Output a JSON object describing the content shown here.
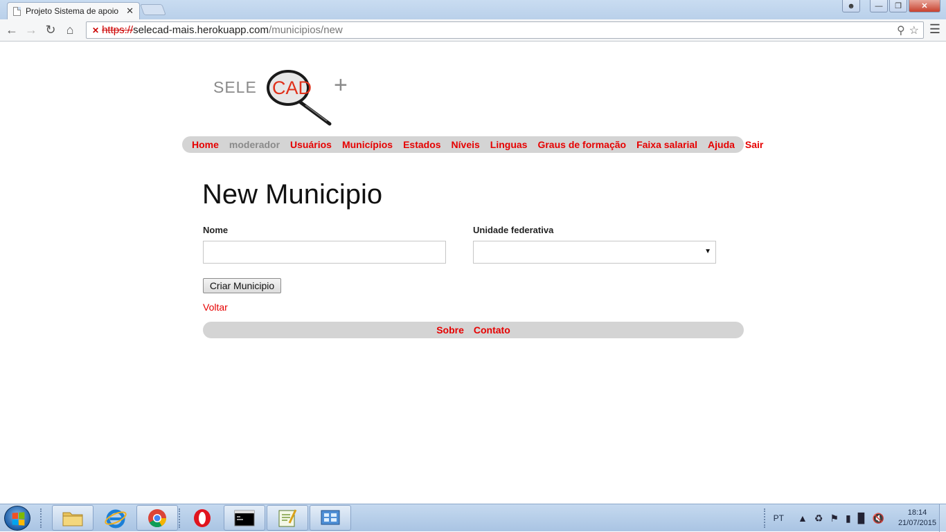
{
  "browser": {
    "tab_title": "Projeto Sistema de apoio",
    "url_scheme": "https://",
    "url_host": "selecad-mais.herokuapp.com",
    "url_path": "/municipios/new"
  },
  "logo": {
    "text_left": "SELE",
    "text_magnified": "CAD",
    "text_plus": "+"
  },
  "nav": {
    "items": [
      {
        "label": "Home",
        "current": false
      },
      {
        "label": "moderador",
        "current": true
      },
      {
        "label": "Usuários",
        "current": false
      },
      {
        "label": "Municípios",
        "current": false
      },
      {
        "label": "Estados",
        "current": false
      },
      {
        "label": "Níveis",
        "current": false
      },
      {
        "label": "Linguas",
        "current": false
      },
      {
        "label": "Graus de formação",
        "current": false
      },
      {
        "label": "Faixa salarial",
        "current": false
      },
      {
        "label": "Ajuda",
        "current": false
      },
      {
        "label": "Sair",
        "current": false
      }
    ]
  },
  "form": {
    "title": "New Municipio",
    "nome_label": "Nome",
    "nome_value": "",
    "uf_label": "Unidade federativa",
    "uf_value": "",
    "submit_label": "Criar Municipio",
    "back_label": "Voltar"
  },
  "footer": {
    "links": [
      "Sobre",
      "Contato"
    ]
  },
  "taskbar": {
    "language": "PT",
    "time": "18:14",
    "date": "21/07/2015"
  },
  "colors": {
    "link_red": "#e60000",
    "nav_bar": "#d4d4d4",
    "nav_current": "#8a8a8a"
  }
}
